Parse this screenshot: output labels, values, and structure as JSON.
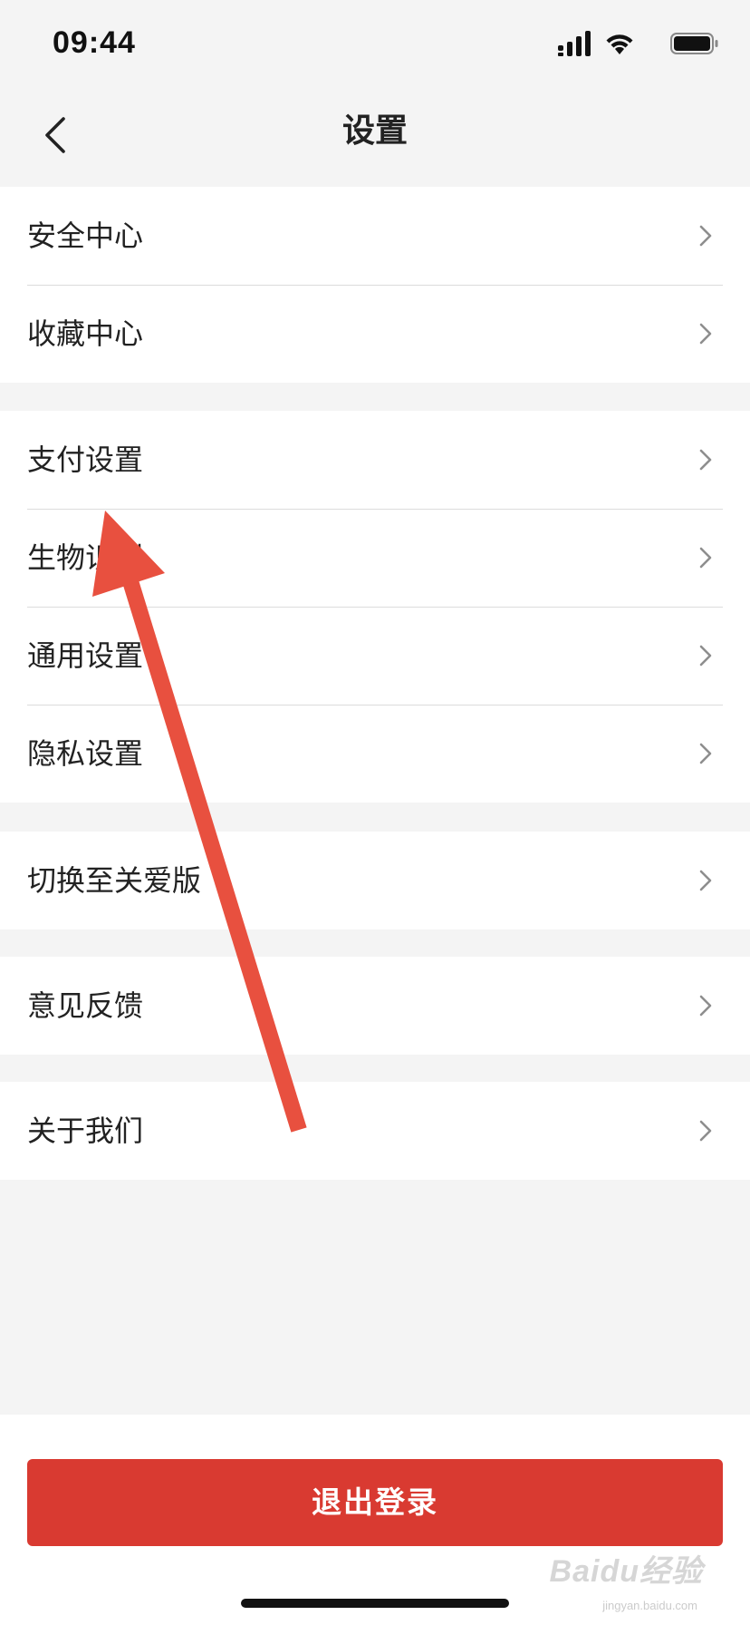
{
  "status_bar": {
    "time": "09:44",
    "icons": [
      "cellular-signal-icon",
      "wifi-icon",
      "battery-icon"
    ]
  },
  "nav": {
    "title": "设置",
    "back_icon": "chevron-left-icon"
  },
  "groups": [
    {
      "items": [
        {
          "label": "安全中心"
        },
        {
          "label": "收藏中心"
        }
      ]
    },
    {
      "items": [
        {
          "label": "支付设置"
        },
        {
          "label": "生物识别"
        },
        {
          "label": "通用设置"
        },
        {
          "label": "隐私设置"
        }
      ]
    },
    {
      "items": [
        {
          "label": "切换至关爱版"
        }
      ]
    },
    {
      "items": [
        {
          "label": "意见反馈"
        }
      ]
    },
    {
      "items": [
        {
          "label": "关于我们"
        }
      ]
    }
  ],
  "logout": {
    "label": "退出登录"
  },
  "watermark": {
    "text": "Baidu经验",
    "sub": "jingyan.baidu.com"
  },
  "colors": {
    "background": "#f4f4f4",
    "accent": "#d93a31",
    "annotation_arrow": "#e8503f"
  }
}
